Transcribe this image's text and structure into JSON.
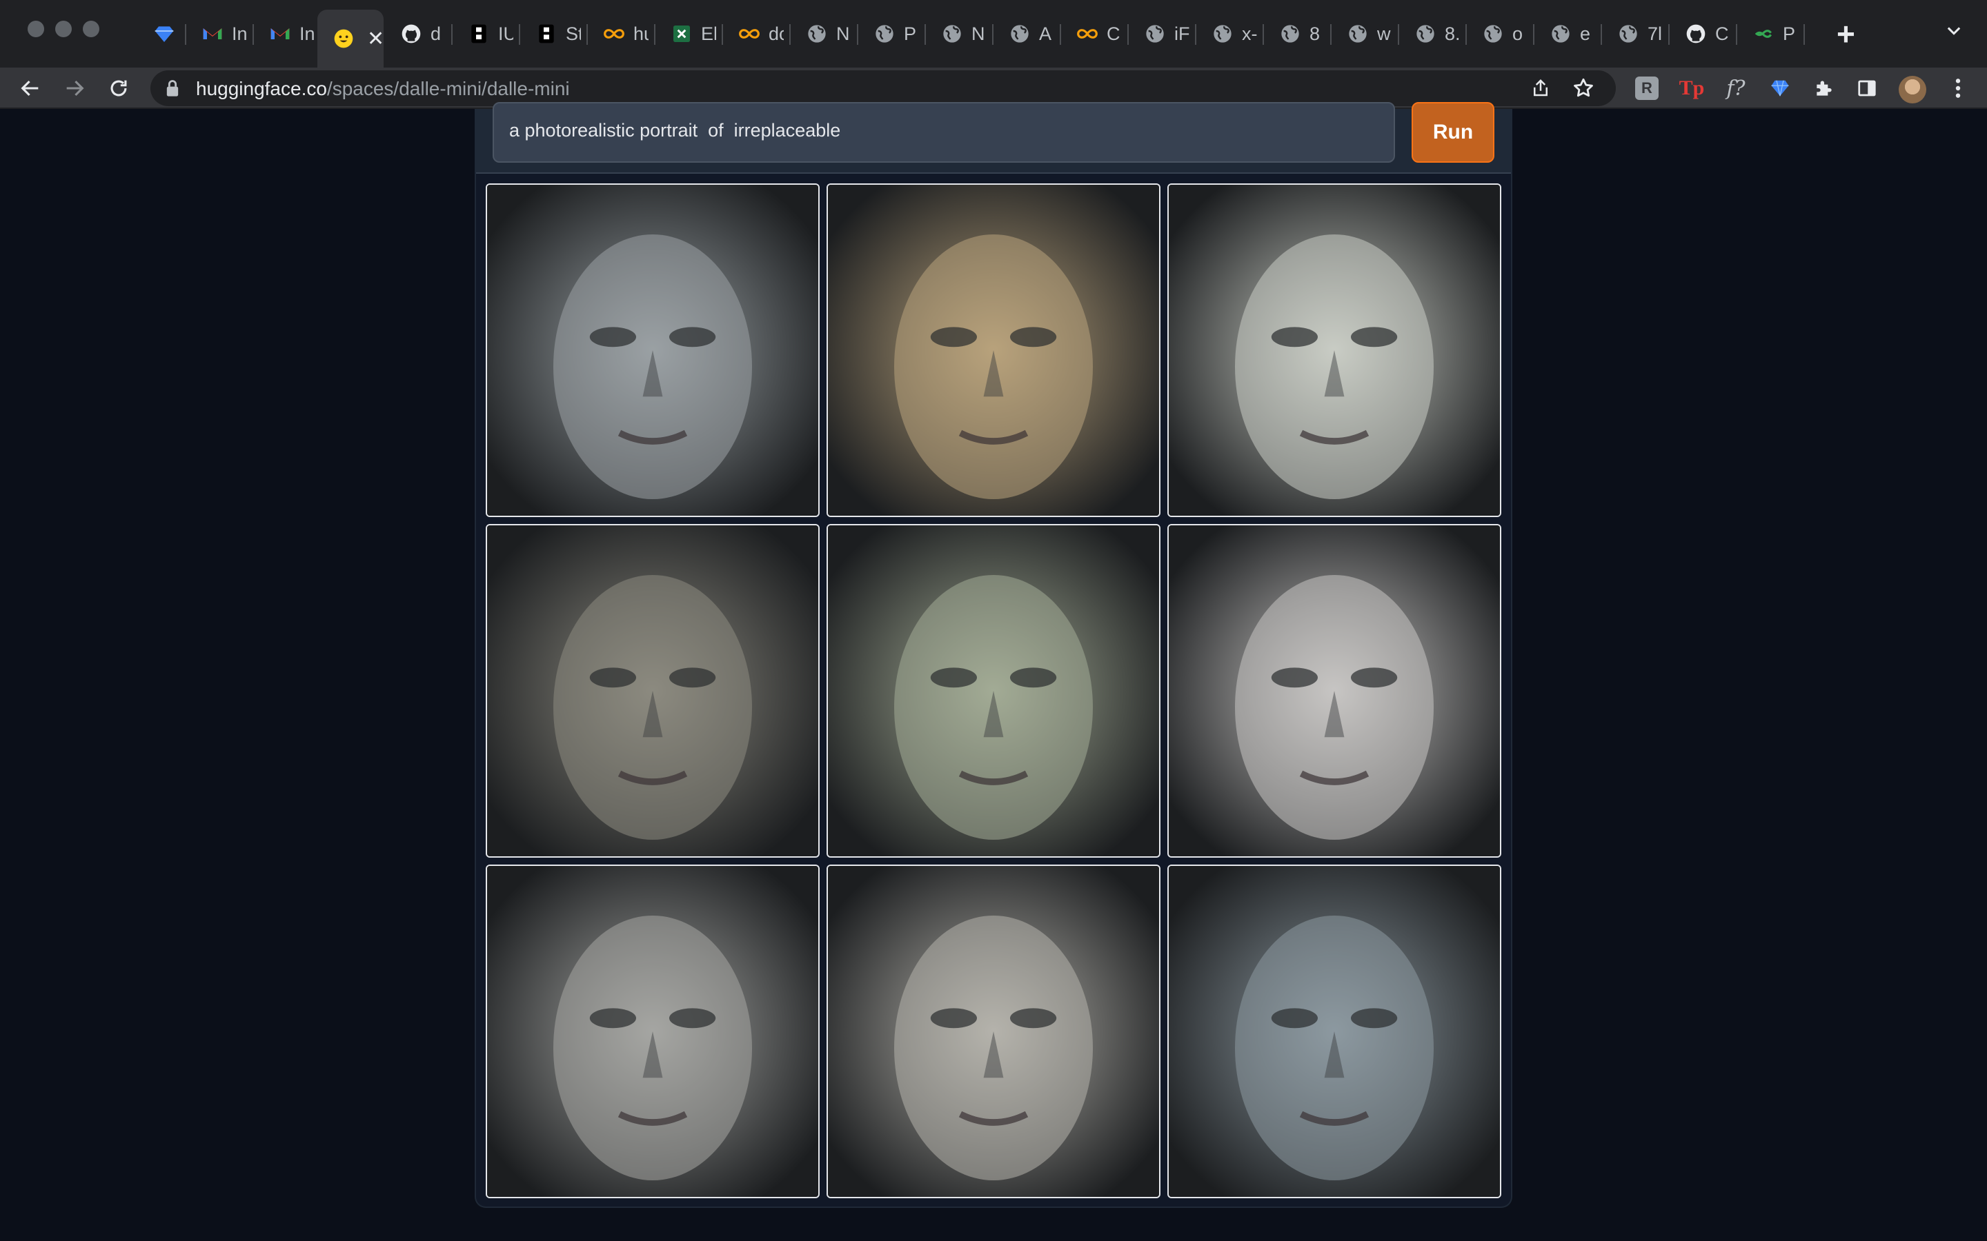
{
  "browser": {
    "tabs": [
      {
        "title": "",
        "icon": "gem-icon"
      },
      {
        "title": "In",
        "icon": "gmail-icon"
      },
      {
        "title": "In",
        "icon": "gmail-icon"
      },
      {
        "title": "",
        "icon": "hugging-face-icon",
        "active": true
      },
      {
        "title": "d",
        "icon": "github-icon"
      },
      {
        "title": "IU",
        "icon": "app-icon"
      },
      {
        "title": "St",
        "icon": "app-icon"
      },
      {
        "title": "hu",
        "icon": "infinity-icon"
      },
      {
        "title": "El",
        "icon": "excel-icon"
      },
      {
        "title": "dc",
        "icon": "infinity-icon"
      },
      {
        "title": "N",
        "icon": "globe-icon"
      },
      {
        "title": "P",
        "icon": "globe-icon"
      },
      {
        "title": "N",
        "icon": "globe-icon"
      },
      {
        "title": "A",
        "icon": "globe-icon"
      },
      {
        "title": "C",
        "icon": "infinity-icon"
      },
      {
        "title": "iF",
        "icon": "globe-icon"
      },
      {
        "title": "x-",
        "icon": "globe-icon"
      },
      {
        "title": "8",
        "icon": "globe-icon"
      },
      {
        "title": "w",
        "icon": "globe-icon"
      },
      {
        "title": "8.",
        "icon": "globe-icon"
      },
      {
        "title": "o",
        "icon": "globe-icon"
      },
      {
        "title": "e",
        "icon": "globe-icon"
      },
      {
        "title": "7l",
        "icon": "globe-icon"
      },
      {
        "title": "C",
        "icon": "github-icon"
      },
      {
        "title": "P",
        "icon": "link-icon"
      }
    ],
    "url_host": "huggingface.co",
    "url_path": "/spaces/dalle-mini/dalle-mini",
    "extensions": {
      "r_label": "R",
      "tp_label": "Tp",
      "f_label": "f?"
    }
  },
  "app": {
    "prompt_value": "a photorealistic portrait  of  irreplaceable",
    "run_label": "Run",
    "images": [
      {
        "name": "portrait-1",
        "tone": "#9aa1a4"
      },
      {
        "name": "portrait-2",
        "tone": "#b8a27c"
      },
      {
        "name": "portrait-3",
        "tone": "#c9ccc4"
      },
      {
        "name": "portrait-4",
        "tone": "#8c8a80"
      },
      {
        "name": "portrait-5",
        "tone": "#a3ab95"
      },
      {
        "name": "portrait-6",
        "tone": "#c7c5c3"
      },
      {
        "name": "portrait-7",
        "tone": "#a5a6a3"
      },
      {
        "name": "portrait-8",
        "tone": "#b5b3ac"
      },
      {
        "name": "portrait-9",
        "tone": "#8d99a0"
      }
    ]
  },
  "colors": {
    "page_bg": "#0b0f19",
    "panel_bg": "#111827",
    "run_button": "#c2621f"
  }
}
